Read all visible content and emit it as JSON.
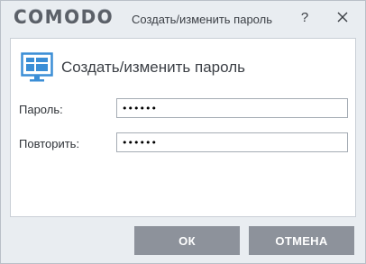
{
  "titlebar": {
    "brand": "COMODO",
    "title": "Создать/изменить пароль",
    "help_glyph": "?",
    "help_icon": "help-icon",
    "close_icon": "close-icon"
  },
  "panel": {
    "icon": "monitor-icon",
    "title": "Создать/изменить пароль"
  },
  "form": {
    "password_label": "Пароль:",
    "password_value": "••••••",
    "repeat_label": "Повторить:",
    "repeat_value": "••••••"
  },
  "buttons": {
    "ok_label": "ОК",
    "cancel_label": "ОТМЕНА"
  },
  "colors": {
    "accent_icon": "#3b8ed6",
    "button_bg": "#8d929b",
    "window_bg": "#e9edf1"
  }
}
